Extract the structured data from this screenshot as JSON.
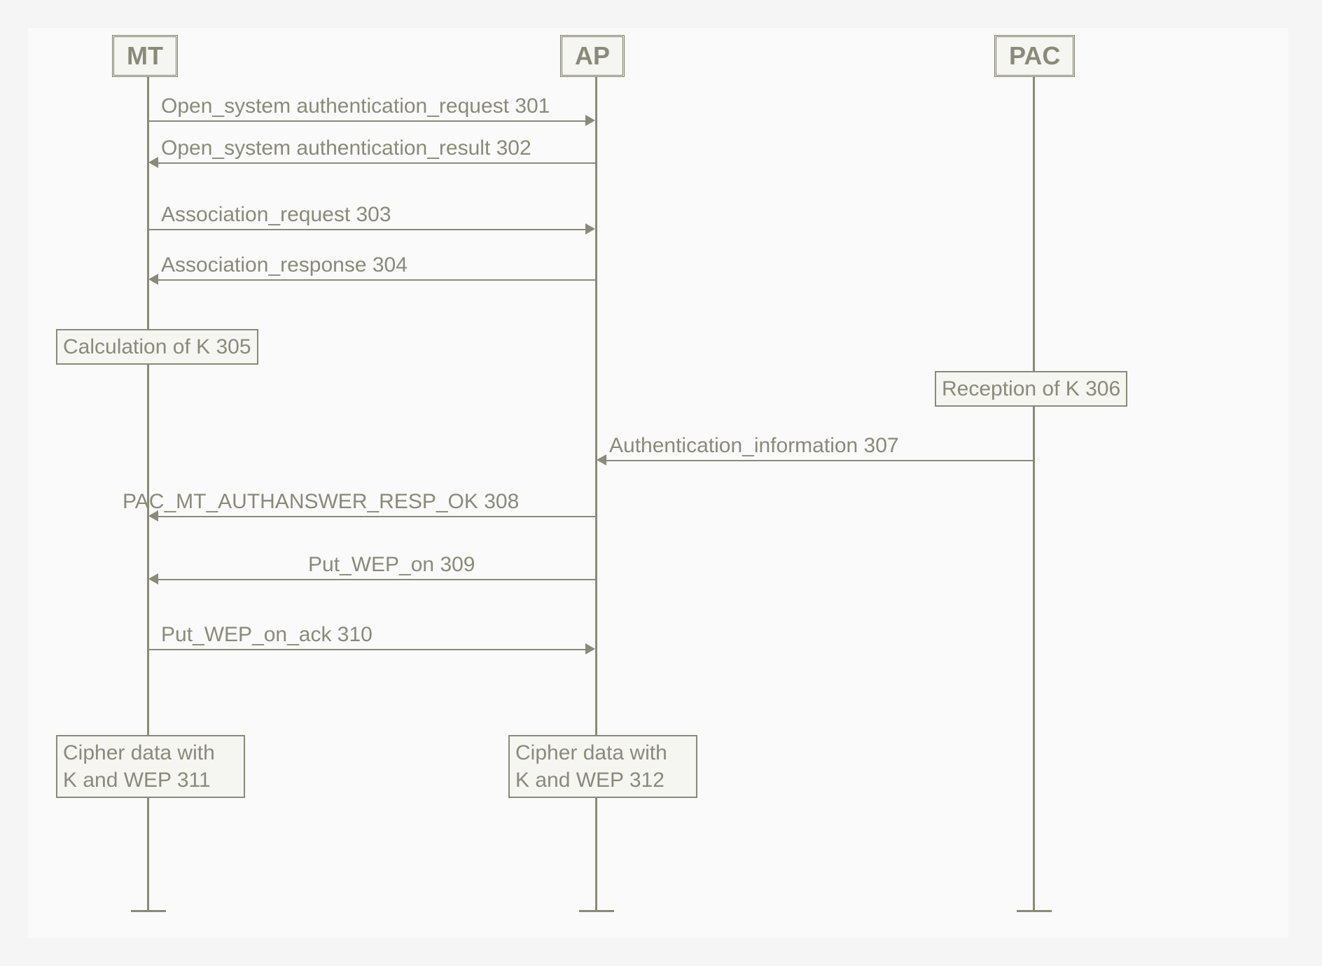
{
  "actors": {
    "mt": "MT",
    "ap": "AP",
    "pac": "PAC"
  },
  "messages": {
    "m301": "Open_system authentication_request 301",
    "m302": "Open_system authentication_result 302",
    "m303": "Association_request 303",
    "m304": "Association_response 304",
    "m307": "Authentication_information 307",
    "m308": "PAC_MT_AUTHANSWER_RESP_OK 308",
    "m309": "Put_WEP_on 309",
    "m310": "Put_WEP_on_ack 310"
  },
  "activities": {
    "a305": "Calculation of K 305",
    "a306": "Reception of K 306",
    "a311": "Cipher data with\nK and WEP 311",
    "a312": "Cipher data with\nK and WEP 312"
  }
}
